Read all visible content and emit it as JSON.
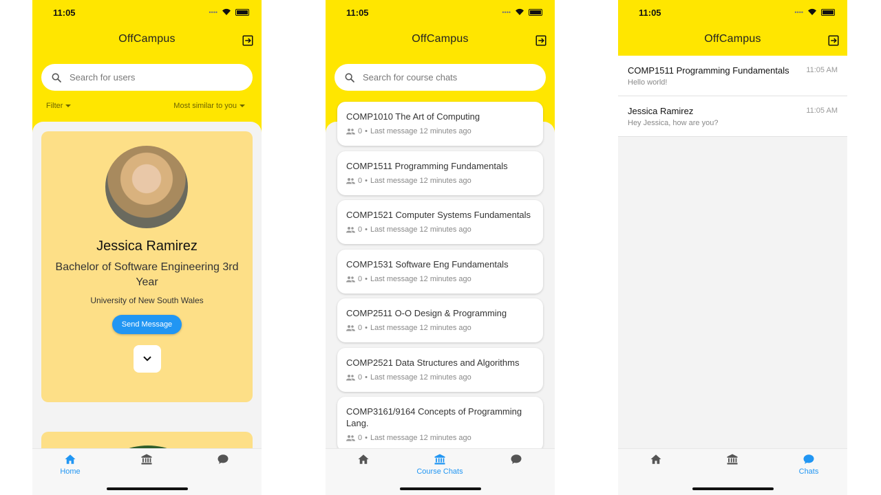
{
  "status": {
    "time": "11:05"
  },
  "app": {
    "title": "OffCampus"
  },
  "screen_home": {
    "search_placeholder": "Search for users",
    "filter_label": "Filter",
    "sort_label": "Most similar to you",
    "profile": {
      "name": "Jessica Ramirez",
      "degree": "Bachelor of Software Engineering 3rd Year",
      "university": "University of New South Wales",
      "send_label": "Send Message"
    }
  },
  "screen_courses": {
    "search_placeholder": "Search for course chats",
    "courses": [
      {
        "title": "COMP1010 The Art of Computing",
        "members": "0",
        "last": "Last message 12 minutes ago"
      },
      {
        "title": "COMP1511 Programming Fundamentals",
        "members": "0",
        "last": "Last message 12 minutes ago"
      },
      {
        "title": "COMP1521 Computer Systems Fundamentals",
        "members": "0",
        "last": "Last message 12 minutes ago"
      },
      {
        "title": "COMP1531 Software Eng Fundamentals",
        "members": "0",
        "last": "Last message 12 minutes ago"
      },
      {
        "title": "COMP2511 O-O Design & Programming",
        "members": "0",
        "last": "Last message 12 minutes ago"
      },
      {
        "title": "COMP2521 Data Structures and Algorithms",
        "members": "0",
        "last": "Last message 12 minutes ago"
      },
      {
        "title": "COMP3161/9164 Concepts of Programming Lang.",
        "members": "0",
        "last": "Last message 12 minutes ago"
      }
    ],
    "separator": "•"
  },
  "screen_chats": {
    "chats": [
      {
        "name": "COMP1511 Programming Fundamentals",
        "message": "Hello world!",
        "time": "11:05 AM"
      },
      {
        "name": "Jessica Ramirez",
        "message": "Hey Jessica, how are you?",
        "time": "11:05 AM"
      }
    ]
  },
  "tabs": {
    "home": "Home",
    "courses": "Course Chats",
    "chats": "Chats"
  },
  "colors": {
    "brand_yellow": "#ffe600",
    "accent_blue": "#2196f3",
    "card_yellow": "#fddf87"
  },
  "icons": [
    "logout-icon",
    "search-icon",
    "home-icon",
    "bank-icon",
    "chat-bubble-icon",
    "people-icon",
    "chevron-down-icon"
  ]
}
